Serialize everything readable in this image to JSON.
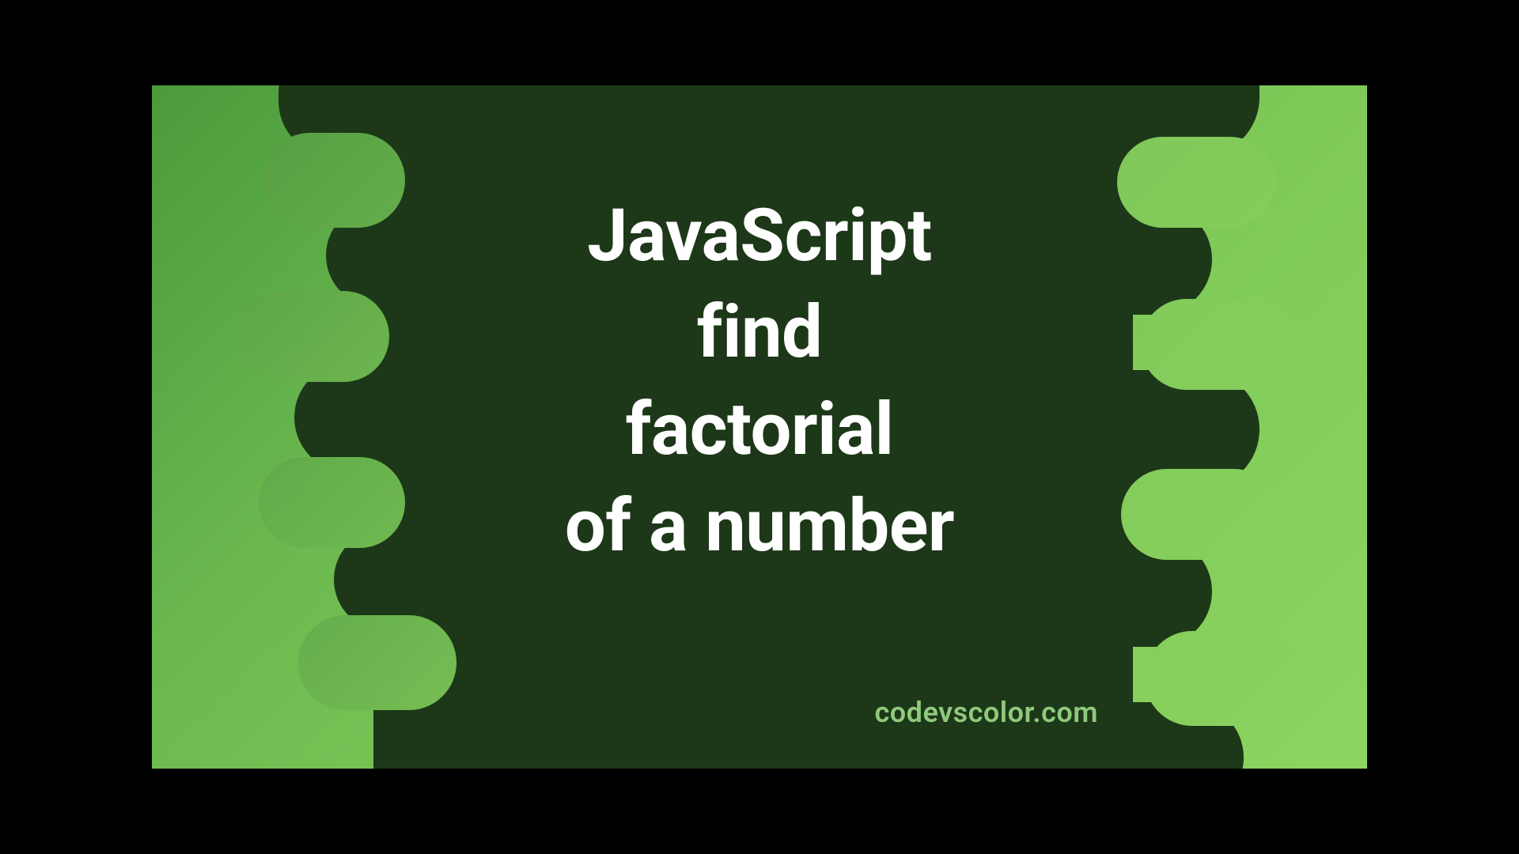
{
  "banner": {
    "title_lines": [
      "JavaScript",
      "find",
      "factorial",
      "of a number"
    ],
    "watermark": "codevscolor.com"
  },
  "colors": {
    "bg_gradient_start": "#4a9a3c",
    "bg_gradient_end": "#8dd460",
    "blob_dark": "#1d3818",
    "title_text": "#ffffff",
    "watermark_text": "#8fc97e"
  }
}
